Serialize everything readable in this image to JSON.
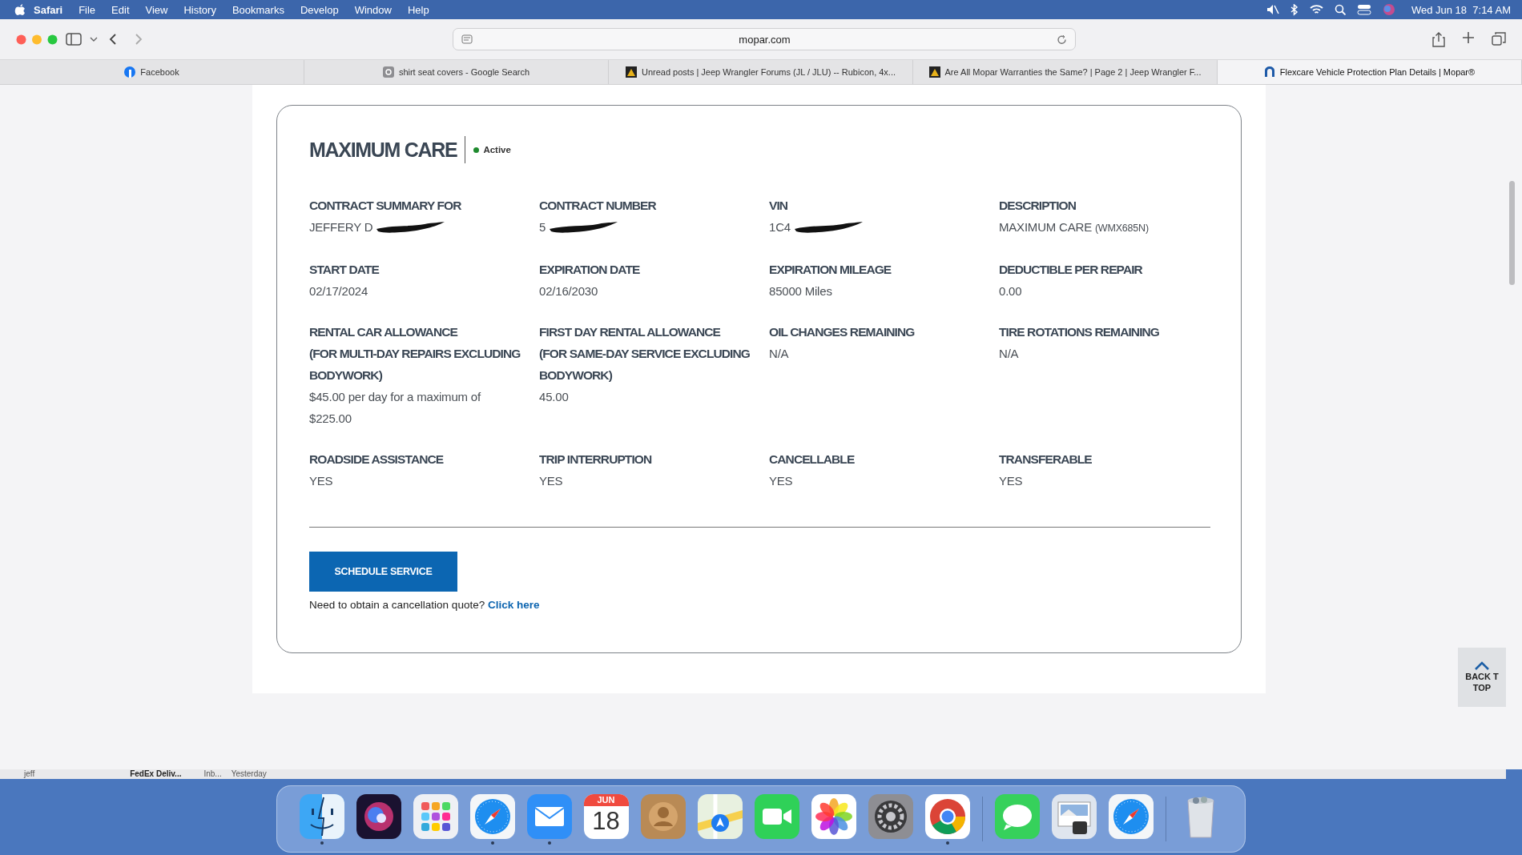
{
  "menubar": {
    "app": "Safari",
    "menus": [
      "File",
      "Edit",
      "View",
      "History",
      "Bookmarks",
      "Develop",
      "Window",
      "Help"
    ],
    "clock": "Wed Jun 18  7:14 AM"
  },
  "toolbar": {
    "address": "mopar.com"
  },
  "tabs": [
    {
      "label": "Facebook",
      "kind": "round",
      "selected": false
    },
    {
      "label": "shirt seat covers - Google Search",
      "kind": "square",
      "selected": false
    },
    {
      "label": "Unread posts | Jeep Wrangler Forums (JL / JLU) -- Rubicon, 4x...",
      "kind": "triangle",
      "selected": false
    },
    {
      "label": "Are All Mopar Warranties the Same? | Page 2 | Jeep Wrangler F...",
      "kind": "triangle",
      "selected": false
    },
    {
      "label": "Flexcare Vehicle Protection Plan Details | Mopar®",
      "kind": "arch",
      "selected": true
    }
  ],
  "card": {
    "title": "MAXIMUM CARE",
    "status": {
      "label": "Active",
      "active": true
    },
    "fields": [
      {
        "label": [
          "CONTRACT SUMMARY FOR"
        ],
        "value": "JEFFERY D",
        "redacted": true
      },
      {
        "label": [
          "CONTRACT NUMBER"
        ],
        "value": "5",
        "redacted": true
      },
      {
        "label": [
          "VIN"
        ],
        "value": "1C4",
        "redacted": true
      },
      {
        "label": [
          "DESCRIPTION"
        ],
        "value": "MAXIMUM CARE",
        "code": "(WMX685N)"
      },
      {
        "label": [
          "START DATE"
        ],
        "value": "02/17/2024"
      },
      {
        "label": [
          "EXPIRATION DATE"
        ],
        "value": "02/16/2030"
      },
      {
        "label": [
          "EXPIRATION MILEAGE"
        ],
        "value": "85000 Miles"
      },
      {
        "label": [
          "DEDUCTIBLE PER REPAIR"
        ],
        "value": "0.00"
      },
      {
        "label": [
          "RENTAL CAR ALLOWANCE",
          "(FOR MULTI-DAY REPAIRS EXCLUDING",
          "BODYWORK)"
        ],
        "value": "$45.00 per day for a maximum of $225.00"
      },
      {
        "label": [
          "FIRST DAY RENTAL ALLOWANCE",
          "(FOR SAME-DAY SERVICE EXCLUDING",
          "BODYWORK)"
        ],
        "value": "45.00"
      },
      {
        "label": [
          "OIL CHANGES REMAINING"
        ],
        "value": "N/A"
      },
      {
        "label": [
          "TIRE ROTATIONS REMAINING"
        ],
        "value": "N/A"
      },
      {
        "label": [
          "ROADSIDE ASSISTANCE"
        ],
        "value": "YES"
      },
      {
        "label": [
          "TRIP INTERRUPTION"
        ],
        "value": "YES"
      },
      {
        "label": [
          "CANCELLABLE"
        ],
        "value": "YES"
      },
      {
        "label": [
          "TRANSFERABLE"
        ],
        "value": "YES"
      }
    ],
    "button": "SCHEDULE SERVICE",
    "note": "Need to obtain a cancellation quote?",
    "link": "Click here"
  },
  "back_to_top": [
    "BACK T",
    "TOP"
  ],
  "behind_window": [
    "jeff",
    "FedEx Deliv...",
    "Inb...",
    "Yesterday"
  ],
  "dock": [
    {
      "kind": "finder",
      "running": true
    },
    {
      "kind": "orb",
      "running": false
    },
    {
      "kind": "grid",
      "running": false
    },
    {
      "kind": "compass",
      "running": true
    },
    {
      "kind": "mail",
      "running": true
    },
    {
      "kind": "calendar",
      "month": "JUN",
      "day": "18",
      "running": false
    },
    {
      "kind": "contacts",
      "running": false
    },
    {
      "kind": "maps",
      "running": false
    },
    {
      "kind": "video",
      "running": false
    },
    {
      "kind": "flower",
      "running": false
    },
    {
      "kind": "gear",
      "running": false
    },
    {
      "kind": "chrome",
      "running": true
    },
    {
      "kind": "separator"
    },
    {
      "kind": "messages",
      "running": false
    },
    {
      "kind": "preview",
      "running": false
    },
    {
      "kind": "compass",
      "running": false
    },
    {
      "kind": "separator"
    },
    {
      "kind": "trash",
      "running": false
    }
  ]
}
